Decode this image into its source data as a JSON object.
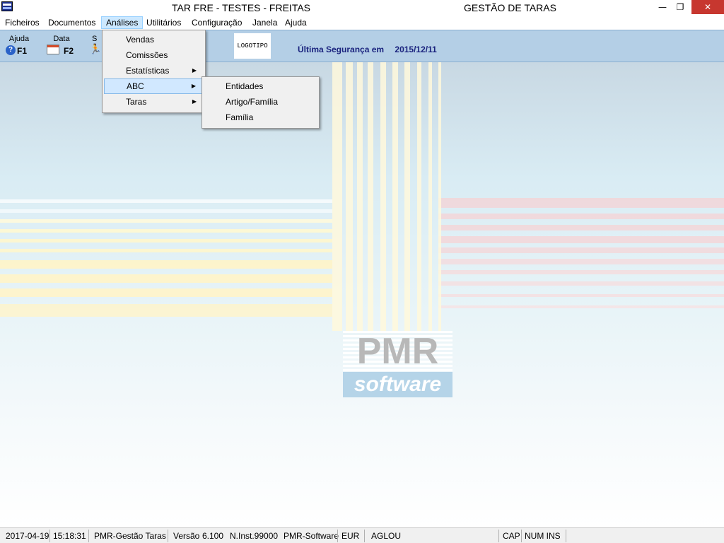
{
  "window": {
    "title": "TAR FRE - TESTES - FREITAS",
    "app_title": "GESTÃO DE TARAS",
    "minimize": "—",
    "restore": "❐",
    "close": "✕"
  },
  "menubar": {
    "items": [
      "Ficheiros",
      "Documentos",
      "Análises",
      "Utilitários",
      "Configuração",
      "Janela",
      "Ajuda"
    ]
  },
  "toolbar": {
    "help": {
      "label": "Ajuda",
      "key": "F1"
    },
    "date": {
      "label": "Data",
      "key": "F2"
    },
    "third_label": "S",
    "logo": "LOGOTIPO",
    "backup_label": "Última Segurança em",
    "backup_date": "2015/12/11"
  },
  "analises_menu": {
    "items": [
      "Vendas",
      "Comissões",
      "Estatísticas",
      "ABC",
      "Taras"
    ],
    "arrow": "▶"
  },
  "abc_submenu": {
    "items": [
      "Entidades",
      "Artigo/Família",
      "Família"
    ]
  },
  "background_logo": {
    "brand": "PMR",
    "tagline": "software"
  },
  "statusbar": {
    "date": "2017-04-19",
    "time": "15:18:31",
    "product": "PMR-Gestão Taras",
    "version_label": "Versão",
    "version": "6.100",
    "install": "N.Inst.99000",
    "company": "PMR-Software",
    "currency": "EUR",
    "user": "AGLOU",
    "caps": "CAP",
    "numlock": "NUM INS"
  }
}
